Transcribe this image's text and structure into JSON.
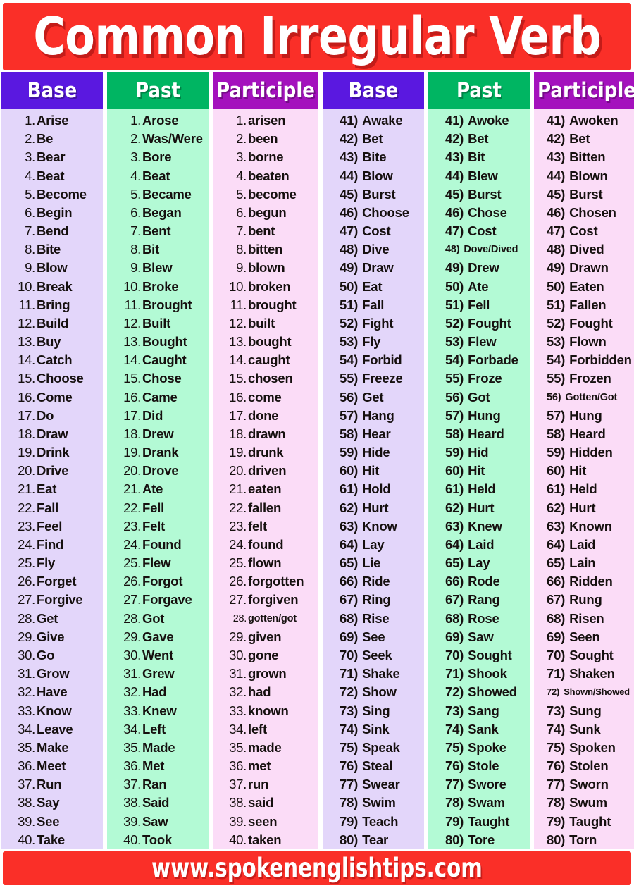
{
  "title": "Common Irregular Verb",
  "footer": "www.spokenenglishtips.com",
  "colors": {
    "title_bg": "#fa2f28",
    "footer_bg": "#fa2f28",
    "header_base": "#5a18e0",
    "header_past": "#00b562",
    "header_participle": "#a411bd",
    "body_base": "#e3d6fa",
    "body_past": "#b3fad5",
    "body_participle": "#fbdcf7",
    "text": "#16100f"
  },
  "headers": {
    "base": "Base",
    "past": "Past",
    "participle": "Participle"
  },
  "left_group": {
    "numbering_style": "1.",
    "base": [
      "Arise",
      "Be",
      "Bear",
      "Beat",
      "Become",
      "Begin",
      "Bend",
      "Bite",
      "Blow",
      "Break",
      "Bring",
      "Build",
      "Buy",
      "Catch",
      "Choose",
      "Come",
      "Do",
      "Draw",
      "Drink",
      "Drive",
      "Eat",
      "Fall",
      "Feel",
      "Find",
      "Fly",
      "Forget",
      "Forgive",
      "Get",
      "Give",
      "Go",
      "Grow",
      "Have",
      "Know",
      "Leave",
      "Make",
      "Meet",
      "Run",
      "Say",
      "See",
      "Take"
    ],
    "past": [
      "Arose",
      "Was/Were",
      "Bore",
      "Beat",
      "Became",
      "Began",
      "Bent",
      "Bit",
      "Blew",
      "Broke",
      "Brought",
      "Built",
      "Bought",
      "Caught",
      "Chose",
      "Came",
      "Did",
      "Drew",
      "Drank",
      "Drove",
      "Ate",
      "Fell",
      "Felt",
      "Found",
      "Flew",
      "Forgot",
      "Forgave",
      "Got",
      "Gave",
      "Went",
      "Grew",
      "Had",
      "Knew",
      "Left",
      "Made",
      "Met",
      "Ran",
      "Said",
      "Saw",
      "Took"
    ],
    "participle": [
      "arisen",
      "been",
      "borne",
      "beaten",
      "become",
      "begun",
      "bent",
      "bitten",
      "blown",
      "broken",
      "brought",
      "built",
      "bought",
      "caught",
      "chosen",
      "come",
      "done",
      "drawn",
      "drunk",
      "driven",
      "eaten",
      "fallen",
      "felt",
      "found",
      "flown",
      "forgotten",
      "forgiven",
      "gotten/got",
      "given",
      "gone",
      "grown",
      "had",
      "known",
      "left",
      "made",
      "met",
      "run",
      "said",
      "seen",
      "taken"
    ]
  },
  "right_group": {
    "numbering_style": "41)",
    "start_number": 41,
    "base": [
      "Awake",
      "Bet",
      "Bite",
      "Blow",
      "Burst",
      "Choose",
      "Cost",
      "Dive",
      "Draw",
      "Eat",
      "Fall",
      "Fight",
      "Fly",
      "Forbid",
      "Freeze",
      "Get",
      "Hang",
      "Hear",
      "Hide",
      "Hit",
      "Hold",
      "Hurt",
      "Know",
      "Lay",
      "Lie",
      "Ride",
      "Ring",
      "Rise",
      "See",
      "Seek",
      "Shake",
      "Show",
      "Sing",
      "Sink",
      "Speak",
      "Steal",
      "Swear",
      "Swim",
      "Teach",
      "Tear"
    ],
    "past": [
      "Awoke",
      "Bet",
      "Bit",
      "Blew",
      "Burst",
      "Chose",
      "Cost",
      "Dove/Dived",
      "Drew",
      "Ate",
      "Fell",
      "Fought",
      "Flew",
      "Forbade",
      "Froze",
      "Got",
      "Hung",
      "Heard",
      "Hid",
      "Hit",
      "Held",
      "Hurt",
      "Knew",
      "Laid",
      "Lay",
      "Rode",
      "Rang",
      "Rose",
      "Saw",
      "Sought",
      "Shook",
      "Showed",
      "Sang",
      "Sank",
      "Spoke",
      "Stole",
      "Swore",
      "Swam",
      "Taught",
      "Tore"
    ],
    "participle": [
      "Awoken",
      "Bet",
      "Bitten",
      "Blown",
      "Burst",
      "Chosen",
      "Cost",
      "Dived",
      "Drawn",
      "Eaten",
      "Fallen",
      "Fought",
      "Flown",
      "Forbidden",
      "Frozen",
      "Gotten/Got",
      "Hung",
      "Heard",
      "Hidden",
      "Hit",
      "Held",
      "Hurt",
      "Known",
      "Laid",
      "Lain",
      "Ridden",
      "Rung",
      "Risen",
      "Seen",
      "Sought",
      "Shaken",
      "Shown/Showed",
      "Sung",
      "Sunk",
      "Spoken",
      "Stolen",
      "Sworn",
      "Swum",
      "Taught",
      "Torn"
    ]
  }
}
